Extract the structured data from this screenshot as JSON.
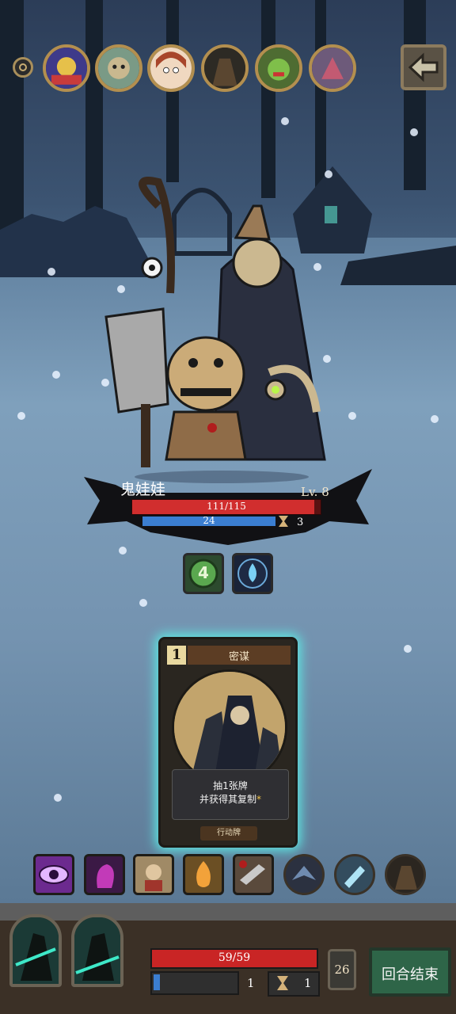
{
  "enemy": {
    "name": "鬼娃娃",
    "level": "Lv. 8",
    "hp_text": "111/115",
    "hp_fraction": 0.965,
    "shield_text": "24",
    "shield_fraction": 1.0,
    "turns": "3"
  },
  "buffs": [
    {
      "name": "poison-counter",
      "value": "4"
    },
    {
      "name": "water-drop"
    }
  ],
  "card": {
    "cost": "1",
    "title": "密谋",
    "desc_line1": "抽1张牌",
    "desc_line2": "并获得其复制",
    "desc_mark": "*",
    "type": "行动牌"
  },
  "top_portraits": [
    "jester-portrait",
    "zombie-portrait",
    "girl-portrait",
    "hooded-portrait",
    "goblin-portrait",
    "warrior-portrait"
  ],
  "hand_items": [
    "eye-skill",
    "spirit-skill",
    "monk-skill",
    "flame-skill",
    "blade-skill",
    "wing-skill",
    "ice-skill",
    "hood-skill"
  ],
  "player": {
    "hp_text": "59/59",
    "hp_fraction": 1.0,
    "shield_value": "1",
    "shield_fraction": 0.04,
    "time_value": "1",
    "deck_count": "26"
  },
  "end_turn_label": "回合结束",
  "colors": {
    "hp_red": "#d12e2e",
    "shield_blue": "#3b7ed1",
    "card_glow": "#5de6e2",
    "end_turn_green": "#2e6548"
  }
}
